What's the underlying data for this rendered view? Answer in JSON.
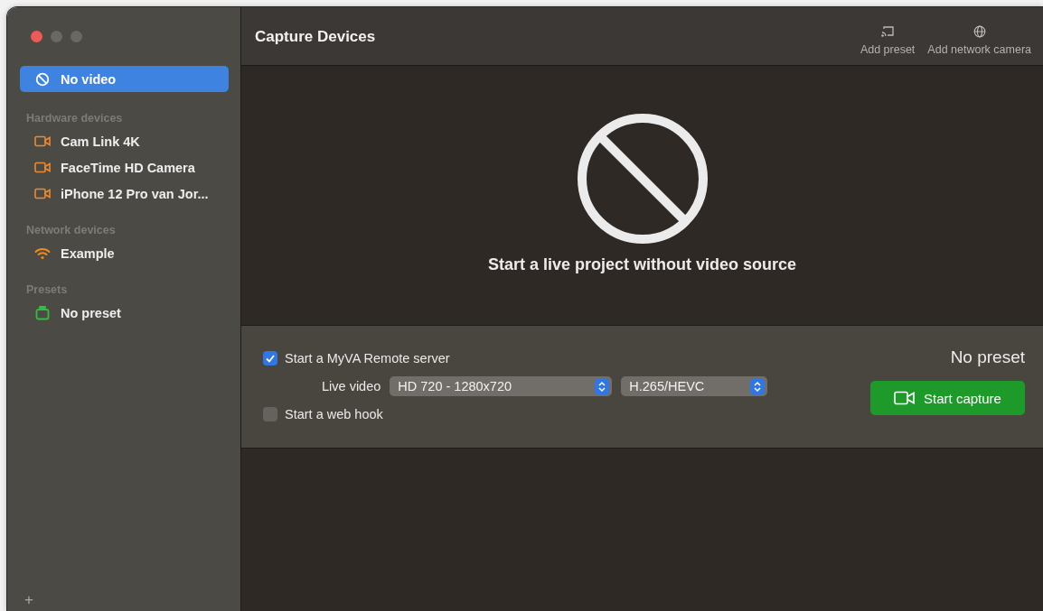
{
  "sidebar": {
    "top_item": {
      "label": "No video",
      "kind": "none",
      "selected": true
    },
    "sections": [
      {
        "title": "Hardware devices",
        "items": [
          {
            "label": "Cam Link 4K",
            "kind": "camera",
            "selected": false
          },
          {
            "label": "FaceTime HD Camera",
            "kind": "camera",
            "selected": false
          },
          {
            "label": "iPhone 12 Pro van Jor...",
            "kind": "camera",
            "selected": false
          }
        ]
      },
      {
        "title": "Network devices",
        "items": [
          {
            "label": "Example",
            "kind": "wifi",
            "selected": false
          }
        ]
      },
      {
        "title": "Presets",
        "items": [
          {
            "label": "No preset",
            "kind": "preset",
            "selected": false
          }
        ]
      }
    ],
    "add_button": "+"
  },
  "header": {
    "title": "Capture Devices",
    "actions": [
      {
        "label": "Add preset",
        "kind": "preset"
      },
      {
        "label": "Add network camera",
        "kind": "network"
      }
    ]
  },
  "preview": {
    "message": "Start a live project without video source"
  },
  "options": {
    "remote_server": {
      "label": "Start a MyVA Remote server",
      "checked": true
    },
    "live_video": {
      "label": "Live video",
      "resolution": "HD 720 - 1280x720",
      "codec": "H.265/HEVC"
    },
    "web_hook": {
      "label": "Start a web hook",
      "checked": false
    },
    "preset_name": "No preset",
    "start_button": "Start capture"
  }
}
